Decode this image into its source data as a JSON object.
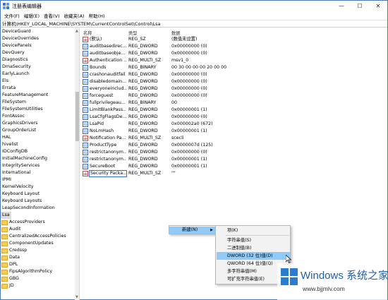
{
  "window": {
    "title": "注册表编辑器",
    "controls": [
      "—",
      "☐",
      "✕"
    ]
  },
  "menu": [
    "文件(F)",
    "编辑(E)",
    "查看(V)",
    "收藏夹(A)",
    "帮助(H)"
  ],
  "address": "计算机\\HKEY_LOCAL_MACHINE\\SYSTEM\\CurrentControlSet\\Control\\Lsa",
  "tree": {
    "items": [
      "DeviceGuard",
      "DeviceOverrides",
      "DevicePanels",
      "DevQuery",
      "Diagnostics",
      "DmaSecurity",
      "EarlyLaunch",
      "Els",
      "Errata",
      "FeatureManagement",
      "FileSystem",
      "FileSystemUtilities",
      "FontAssoc",
      "GraphicsDrivers",
      "GroupOrderList",
      "HAL",
      "hivelist",
      "IDConfigDB",
      "InitialMachineConfig",
      "IntegrityServices",
      "International",
      "IPMI",
      "KernelVelocity",
      "Keyboard Layout",
      "Keyboard Layouts",
      "LeapSecondInformation"
    ],
    "selected": "Lsa",
    "children": [
      "AccessProviders",
      "Audit",
      "CentralizedAccessPolicies",
      "ComponentUpdates",
      "Credssp",
      "Data",
      "DPL",
      "FipsAlgorithmPolicy",
      "GBG",
      "JD"
    ]
  },
  "values_pane": {
    "headers": {
      "name": "名称",
      "type": "类型",
      "data": "数据"
    },
    "rows": [
      {
        "icon": "sz",
        "name": "(默认)",
        "type": "REG_SZ",
        "data": "(数值未设置)"
      },
      {
        "icon": "bin",
        "name": "auditbasedirec...",
        "type": "REG_DWORD",
        "data": "0x00000000 (0)"
      },
      {
        "icon": "bin",
        "name": "auditbaseobje...",
        "type": "REG_DWORD",
        "data": "0x00000000 (0)"
      },
      {
        "icon": "sz",
        "name": "Authentication ...",
        "type": "REG_MULTI_SZ",
        "data": "msv1_0"
      },
      {
        "icon": "bin",
        "name": "Bounds",
        "type": "REG_BINARY",
        "data": "00 30 00 00 00 20 00 00"
      },
      {
        "icon": "bin",
        "name": "crashonauditfail",
        "type": "REG_DWORD",
        "data": "0x00000000 (0)"
      },
      {
        "icon": "bin",
        "name": "disabledomain...",
        "type": "REG_DWORD",
        "data": "0x00000000 (0)"
      },
      {
        "icon": "bin",
        "name": "everyoneinclud...",
        "type": "REG_DWORD",
        "data": "0x00000000 (0)"
      },
      {
        "icon": "bin",
        "name": "forceguest",
        "type": "REG_DWORD",
        "data": "0x00000000 (0)"
      },
      {
        "icon": "bin",
        "name": "fullprivilegeau...",
        "type": "REG_BINARY",
        "data": "00"
      },
      {
        "icon": "bin",
        "name": "LimitBlankPass...",
        "type": "REG_DWORD",
        "data": "0x00000001 (1)"
      },
      {
        "icon": "bin",
        "name": "LsaCfgFlagsDe...",
        "type": "REG_DWORD",
        "data": "0x00000000 (0)"
      },
      {
        "icon": "bin",
        "name": "LsaPid",
        "type": "REG_DWORD",
        "data": "0x000002a0 (672)"
      },
      {
        "icon": "bin",
        "name": "NoLmHash",
        "type": "REG_DWORD",
        "data": "0x00000001 (1)"
      },
      {
        "icon": "sz",
        "name": "Notification Pa...",
        "type": "REG_MULTI_SZ",
        "data": "scecli"
      },
      {
        "icon": "bin",
        "name": "ProductType",
        "type": "REG_DWORD",
        "data": "0x0000007d (125)"
      },
      {
        "icon": "bin",
        "name": "restrictanonym...",
        "type": "REG_DWORD",
        "data": "0x00000000 (0)"
      },
      {
        "icon": "bin",
        "name": "restrictanonym...",
        "type": "REG_DWORD",
        "data": "0x00000001 (1)"
      },
      {
        "icon": "bin",
        "name": "SecureBoot",
        "type": "REG_DWORD",
        "data": "0x00000001 (1)"
      },
      {
        "icon": "sz",
        "name": "Security Packa...",
        "type": "REG_MULTI_SZ",
        "data": "\"\""
      }
    ]
  },
  "context_menu": {
    "new_label": "新建(N)",
    "submenu": [
      "项(K)",
      "字符串值(S)",
      "二进制值(B)",
      "DWORD (32 位)值(D)",
      "QWORD (64 位)值(Q)",
      "多字符串值(M)",
      "可扩充字符串值(E)"
    ],
    "highlighted_index": 3
  },
  "watermark": {
    "title": "Windows 系统之家",
    "url": "www.bjjmlv.com"
  },
  "icon_colors": {
    "folder": "#f5cd56",
    "selection": "#91c9f7",
    "brand": "#2b7ccf"
  }
}
